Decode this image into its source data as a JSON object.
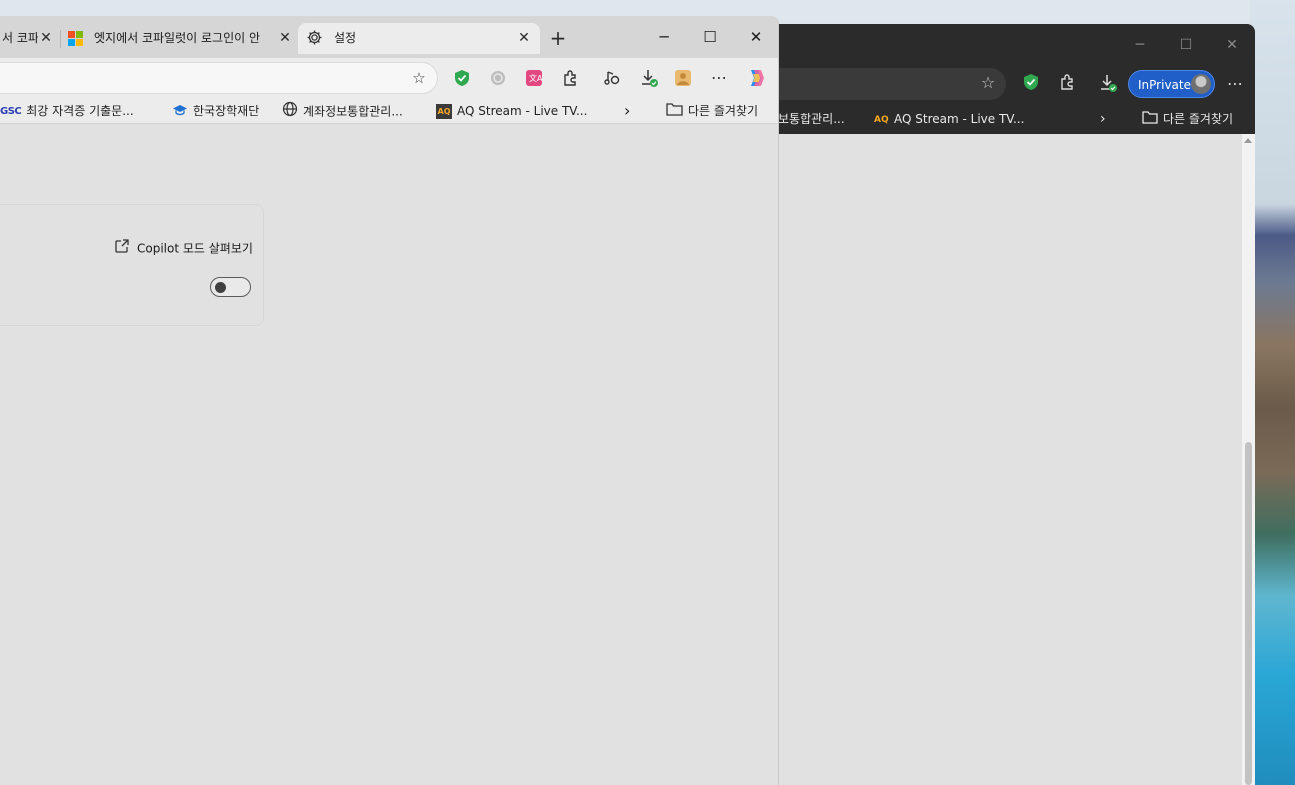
{
  "front_window": {
    "tabs": [
      {
        "label": "서 코파",
        "active": false
      },
      {
        "label": "엣지에서 코파일럿이 로그인이 안",
        "active": false
      },
      {
        "label": "설정",
        "active": true
      }
    ],
    "new_tab_icon": "plus-icon",
    "window_controls": {
      "minimize": "─",
      "maximize": "☐",
      "close": "✕"
    },
    "toolbar_icons": [
      "star-icon",
      "shield-check-icon",
      "circle-extension-icon",
      "translate-icon",
      "puzzle-icon",
      "read-aloud-icon",
      "download-icon",
      "profile-icon",
      "more-icon",
      "copilot-icon"
    ],
    "bookmarks": [
      {
        "label": "최강 자격증 기출문...",
        "icon": "GSC"
      },
      {
        "label": "한국장학재단",
        "icon": "graduation-cap-icon"
      },
      {
        "label": "계좌정보통합관리...",
        "icon": "globe-icon"
      },
      {
        "label": "AQ Stream - Live TV...",
        "icon": "AQ"
      }
    ],
    "bookmarks_more": "›",
    "other_favorites": "다른 즐겨찾기",
    "settings": {
      "copilot_link": "Copilot 모드 살펴보기",
      "toggle_on": false
    }
  },
  "back_window": {
    "window_controls": {
      "minimize": "─",
      "maximize": "☐",
      "close": "✕"
    },
    "inprivate_label": "InPrivate",
    "bookmarks": [
      {
        "label": "보통합관리..."
      },
      {
        "label": "AQ Stream - Live TV...",
        "icon": "AQ"
      }
    ],
    "bookmarks_more": "›",
    "other_favorites": "다른 즐겨찾기"
  },
  "colors": {
    "accent_inprivate": "#1f5fc7",
    "shield_green": "#2fa84f",
    "translate_pink": "#e2477f",
    "aq_orange": "#f5a623"
  }
}
